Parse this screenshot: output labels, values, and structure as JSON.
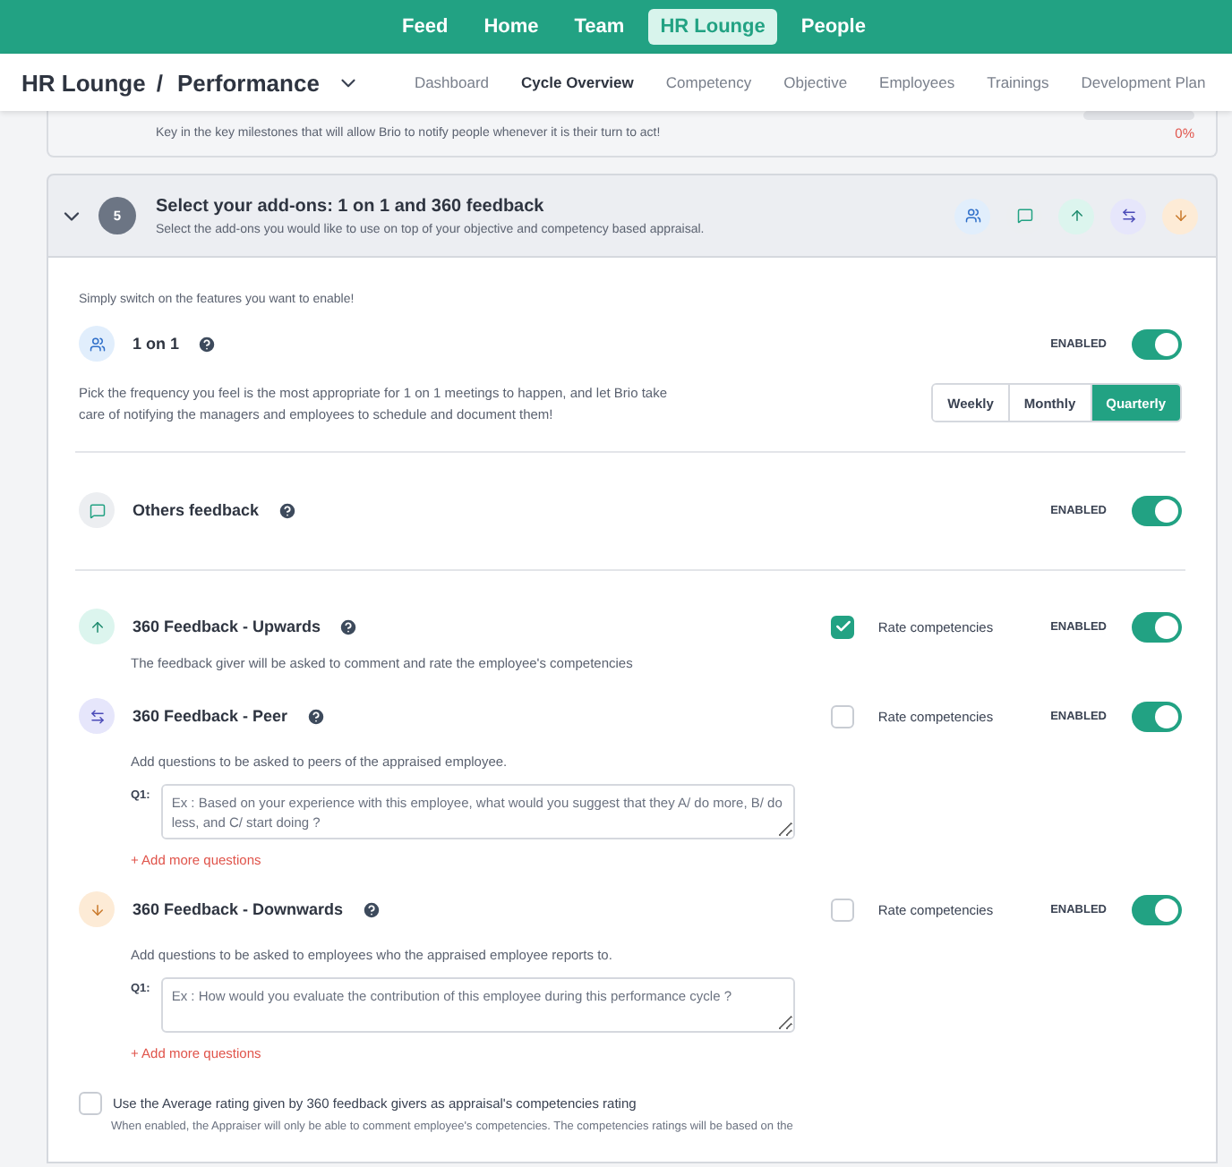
{
  "nav": [
    {
      "label": "Feed",
      "selected": false
    },
    {
      "label": "Home",
      "selected": false
    },
    {
      "label": "Team",
      "selected": false
    },
    {
      "label": "HR Lounge",
      "selected": true
    },
    {
      "label": "People",
      "selected": false
    }
  ],
  "breadcrumb": {
    "section": "HR Lounge",
    "separator": "/",
    "page": "Performance"
  },
  "subtabs": [
    {
      "label": "Dashboard",
      "selected": false
    },
    {
      "label": "Cycle Overview",
      "selected": true
    },
    {
      "label": "Competency",
      "selected": false
    },
    {
      "label": "Objective",
      "selected": false
    },
    {
      "label": "Employees",
      "selected": false
    },
    {
      "label": "Trainings",
      "selected": false
    },
    {
      "label": "Development Plan",
      "selected": false
    }
  ],
  "prev_step": {
    "description": "Key in the key milestones that will allow Brio to notify people whenever it is their turn to act!",
    "level": 0,
    "percent": "0%"
  },
  "step": {
    "number": "5",
    "title": "Select your add-ons: 1 on 1 and 360 feedback",
    "subtitle": "Select the add-ons you would like to use on top of your objective and competency based appraisal.",
    "expanded": true,
    "addons": [
      {
        "kind": "one_on_one"
      },
      {
        "kind": "others"
      },
      {
        "kind": "upwards"
      },
      {
        "kind": "peer"
      },
      {
        "kind": "downwards"
      }
    ]
  },
  "intro": "Simply switch on the features you want to enable!",
  "features": [
    {
      "kind": "one_on_one",
      "title": "1 on 1",
      "status": "ENABLED",
      "on": true,
      "description": "Pick the frequency you feel is the most appropriate for 1 on 1 meetings to happen, and let Brio take care of notifying the managers and employees to schedule and document them!",
      "frequencies": [
        {
          "label": "Weekly",
          "selected": false
        },
        {
          "label": "Monthly",
          "selected": false
        },
        {
          "label": "Quarterly",
          "selected": true
        }
      ]
    },
    {
      "kind": "others",
      "title": "Others feedback",
      "status": "ENABLED",
      "on": true
    },
    {
      "kind": "upwards",
      "title": "360 Feedback - Upwards",
      "status": "ENABLED",
      "on": true,
      "rate_label": "Rate competencies",
      "rate_checked": true,
      "description": "The feedback giver will be asked to comment and rate the employee's competencies"
    },
    {
      "kind": "peer",
      "title": "360 Feedback - Peer",
      "status": "ENABLED",
      "on": true,
      "rate_label": "Rate competencies",
      "rate_checked": false,
      "description": "Add questions to be asked to peers of the appraised employee.",
      "questions": [
        {
          "label": "Q1:",
          "placeholder": "Ex : Based on your experience with this employee, what would you suggest that they A/ do more, B/ do less, and C/ start doing ?"
        }
      ],
      "add_link": "+ Add more questions"
    },
    {
      "kind": "downwards",
      "title": "360 Feedback - Downwards",
      "status": "ENABLED",
      "on": true,
      "rate_label": "Rate competencies",
      "rate_checked": false,
      "description": "Add questions to be asked to employees who the appraised employee reports to.",
      "questions": [
        {
          "label": "Q1:",
          "placeholder": "Ex : How would you evaluate the contribution of this employee during this performance cycle ?"
        }
      ],
      "add_link": "+ Add more questions"
    }
  ],
  "average": {
    "label": "Use the Average rating given by 360 feedback givers as appraisal's competencies rating",
    "checked": false,
    "note": "When enabled, the Appraiser will only be able to comment employee's competencies. The competencies ratings will be based on the"
  }
}
